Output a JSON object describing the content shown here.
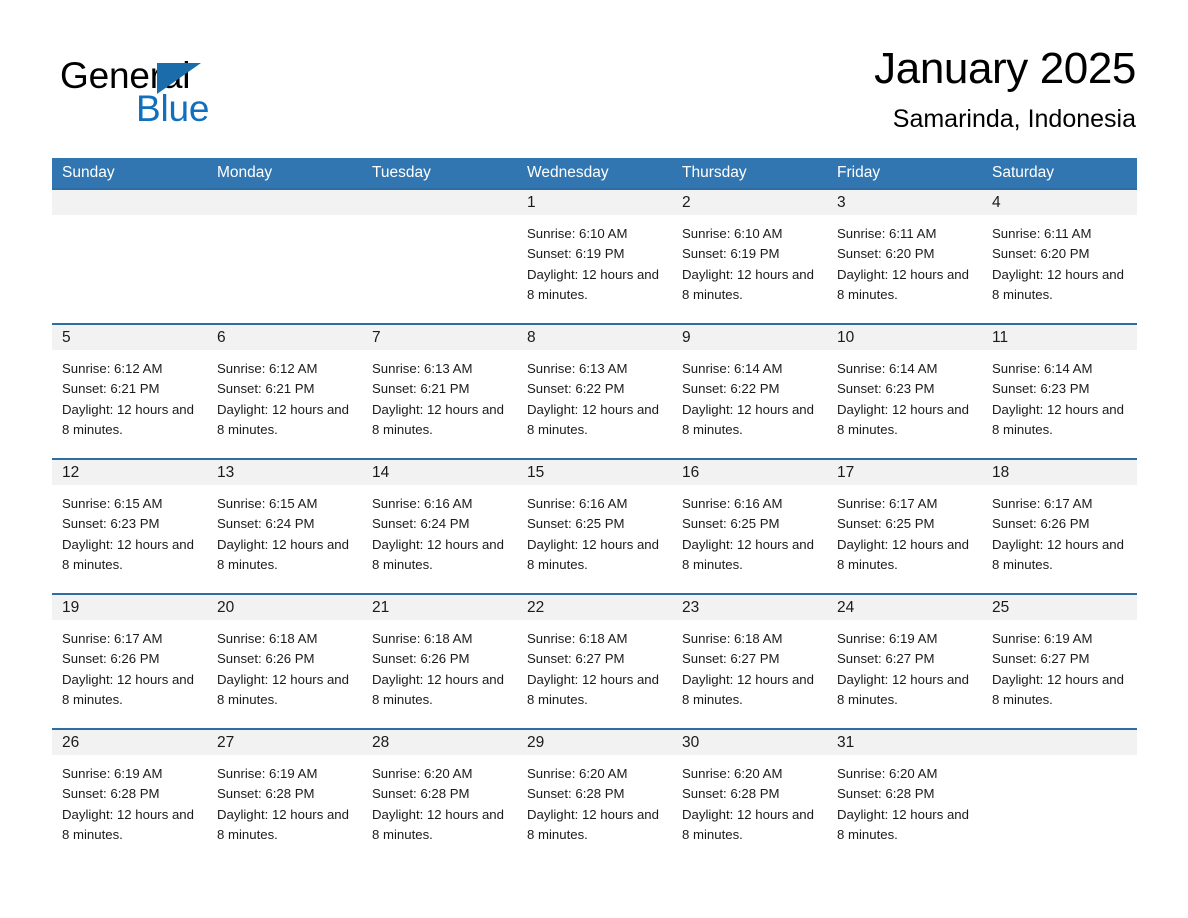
{
  "logo": {
    "word_one": "General",
    "word_two": "Blue",
    "triangle_icon": "triangle-icon",
    "accent_color": "#1170bd"
  },
  "header": {
    "month_title": "January 2025",
    "location": "Samarinda, Indonesia"
  },
  "calendar": {
    "header_color": "#3276b1",
    "row_divider_color": "#2e6da4",
    "day_band_color": "#f2f2f2",
    "weekdays": [
      "Sunday",
      "Monday",
      "Tuesday",
      "Wednesday",
      "Thursday",
      "Friday",
      "Saturday"
    ],
    "weeks": [
      [
        {
          "day": "",
          "sunrise": "",
          "sunset": "",
          "daylight": "",
          "empty": true
        },
        {
          "day": "",
          "sunrise": "",
          "sunset": "",
          "daylight": "",
          "empty": true
        },
        {
          "day": "",
          "sunrise": "",
          "sunset": "",
          "daylight": "",
          "empty": true
        },
        {
          "day": "1",
          "sunrise": "Sunrise: 6:10 AM",
          "sunset": "Sunset: 6:19 PM",
          "daylight": "Daylight: 12 hours and 8 minutes."
        },
        {
          "day": "2",
          "sunrise": "Sunrise: 6:10 AM",
          "sunset": "Sunset: 6:19 PM",
          "daylight": "Daylight: 12 hours and 8 minutes."
        },
        {
          "day": "3",
          "sunrise": "Sunrise: 6:11 AM",
          "sunset": "Sunset: 6:20 PM",
          "daylight": "Daylight: 12 hours and 8 minutes."
        },
        {
          "day": "4",
          "sunrise": "Sunrise: 6:11 AM",
          "sunset": "Sunset: 6:20 PM",
          "daylight": "Daylight: 12 hours and 8 minutes."
        }
      ],
      [
        {
          "day": "5",
          "sunrise": "Sunrise: 6:12 AM",
          "sunset": "Sunset: 6:21 PM",
          "daylight": "Daylight: 12 hours and 8 minutes."
        },
        {
          "day": "6",
          "sunrise": "Sunrise: 6:12 AM",
          "sunset": "Sunset: 6:21 PM",
          "daylight": "Daylight: 12 hours and 8 minutes."
        },
        {
          "day": "7",
          "sunrise": "Sunrise: 6:13 AM",
          "sunset": "Sunset: 6:21 PM",
          "daylight": "Daylight: 12 hours and 8 minutes."
        },
        {
          "day": "8",
          "sunrise": "Sunrise: 6:13 AM",
          "sunset": "Sunset: 6:22 PM",
          "daylight": "Daylight: 12 hours and 8 minutes."
        },
        {
          "day": "9",
          "sunrise": "Sunrise: 6:14 AM",
          "sunset": "Sunset: 6:22 PM",
          "daylight": "Daylight: 12 hours and 8 minutes."
        },
        {
          "day": "10",
          "sunrise": "Sunrise: 6:14 AM",
          "sunset": "Sunset: 6:23 PM",
          "daylight": "Daylight: 12 hours and 8 minutes."
        },
        {
          "day": "11",
          "sunrise": "Sunrise: 6:14 AM",
          "sunset": "Sunset: 6:23 PM",
          "daylight": "Daylight: 12 hours and 8 minutes."
        }
      ],
      [
        {
          "day": "12",
          "sunrise": "Sunrise: 6:15 AM",
          "sunset": "Sunset: 6:23 PM",
          "daylight": "Daylight: 12 hours and 8 minutes."
        },
        {
          "day": "13",
          "sunrise": "Sunrise: 6:15 AM",
          "sunset": "Sunset: 6:24 PM",
          "daylight": "Daylight: 12 hours and 8 minutes."
        },
        {
          "day": "14",
          "sunrise": "Sunrise: 6:16 AM",
          "sunset": "Sunset: 6:24 PM",
          "daylight": "Daylight: 12 hours and 8 minutes."
        },
        {
          "day": "15",
          "sunrise": "Sunrise: 6:16 AM",
          "sunset": "Sunset: 6:25 PM",
          "daylight": "Daylight: 12 hours and 8 minutes."
        },
        {
          "day": "16",
          "sunrise": "Sunrise: 6:16 AM",
          "sunset": "Sunset: 6:25 PM",
          "daylight": "Daylight: 12 hours and 8 minutes."
        },
        {
          "day": "17",
          "sunrise": "Sunrise: 6:17 AM",
          "sunset": "Sunset: 6:25 PM",
          "daylight": "Daylight: 12 hours and 8 minutes."
        },
        {
          "day": "18",
          "sunrise": "Sunrise: 6:17 AM",
          "sunset": "Sunset: 6:26 PM",
          "daylight": "Daylight: 12 hours and 8 minutes."
        }
      ],
      [
        {
          "day": "19",
          "sunrise": "Sunrise: 6:17 AM",
          "sunset": "Sunset: 6:26 PM",
          "daylight": "Daylight: 12 hours and 8 minutes."
        },
        {
          "day": "20",
          "sunrise": "Sunrise: 6:18 AM",
          "sunset": "Sunset: 6:26 PM",
          "daylight": "Daylight: 12 hours and 8 minutes."
        },
        {
          "day": "21",
          "sunrise": "Sunrise: 6:18 AM",
          "sunset": "Sunset: 6:26 PM",
          "daylight": "Daylight: 12 hours and 8 minutes."
        },
        {
          "day": "22",
          "sunrise": "Sunrise: 6:18 AM",
          "sunset": "Sunset: 6:27 PM",
          "daylight": "Daylight: 12 hours and 8 minutes."
        },
        {
          "day": "23",
          "sunrise": "Sunrise: 6:18 AM",
          "sunset": "Sunset: 6:27 PM",
          "daylight": "Daylight: 12 hours and 8 minutes."
        },
        {
          "day": "24",
          "sunrise": "Sunrise: 6:19 AM",
          "sunset": "Sunset: 6:27 PM",
          "daylight": "Daylight: 12 hours and 8 minutes."
        },
        {
          "day": "25",
          "sunrise": "Sunrise: 6:19 AM",
          "sunset": "Sunset: 6:27 PM",
          "daylight": "Daylight: 12 hours and 8 minutes."
        }
      ],
      [
        {
          "day": "26",
          "sunrise": "Sunrise: 6:19 AM",
          "sunset": "Sunset: 6:28 PM",
          "daylight": "Daylight: 12 hours and 8 minutes."
        },
        {
          "day": "27",
          "sunrise": "Sunrise: 6:19 AM",
          "sunset": "Sunset: 6:28 PM",
          "daylight": "Daylight: 12 hours and 8 minutes."
        },
        {
          "day": "28",
          "sunrise": "Sunrise: 6:20 AM",
          "sunset": "Sunset: 6:28 PM",
          "daylight": "Daylight: 12 hours and 8 minutes."
        },
        {
          "day": "29",
          "sunrise": "Sunrise: 6:20 AM",
          "sunset": "Sunset: 6:28 PM",
          "daylight": "Daylight: 12 hours and 8 minutes."
        },
        {
          "day": "30",
          "sunrise": "Sunrise: 6:20 AM",
          "sunset": "Sunset: 6:28 PM",
          "daylight": "Daylight: 12 hours and 8 minutes."
        },
        {
          "day": "31",
          "sunrise": "Sunrise: 6:20 AM",
          "sunset": "Sunset: 6:28 PM",
          "daylight": "Daylight: 12 hours and 8 minutes."
        },
        {
          "day": "",
          "sunrise": "",
          "sunset": "",
          "daylight": "",
          "empty": true
        }
      ]
    ]
  }
}
